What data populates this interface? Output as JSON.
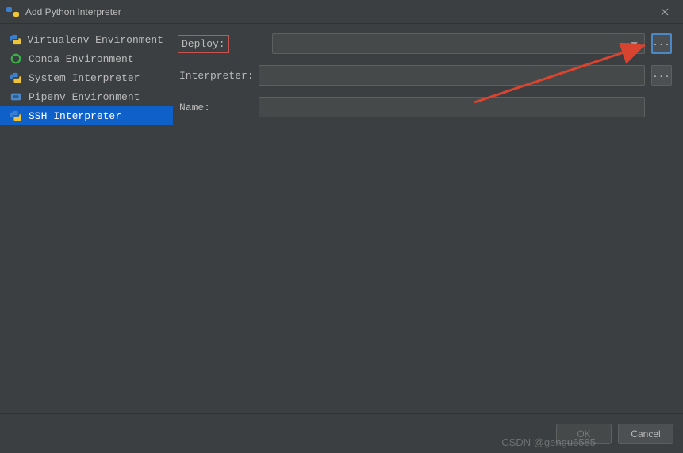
{
  "titlebar": {
    "title": "Add Python Interpreter"
  },
  "sidebar": {
    "items": [
      {
        "label": "Virtualenv Environment"
      },
      {
        "label": "Conda Environment"
      },
      {
        "label": "System Interpreter"
      },
      {
        "label": "Pipenv Environment"
      },
      {
        "label": "SSH Interpreter"
      }
    ],
    "selected_index": 4
  },
  "form": {
    "deploy_label": "Deploy:",
    "deploy_value": "",
    "interpreter_label": "Interpreter:",
    "interpreter_value": "",
    "name_label": "Name:",
    "name_value": "",
    "browse_label": "..."
  },
  "footer": {
    "ok_label": "OK",
    "cancel_label": "Cancel"
  },
  "watermark": "CSDN @gengu6585"
}
